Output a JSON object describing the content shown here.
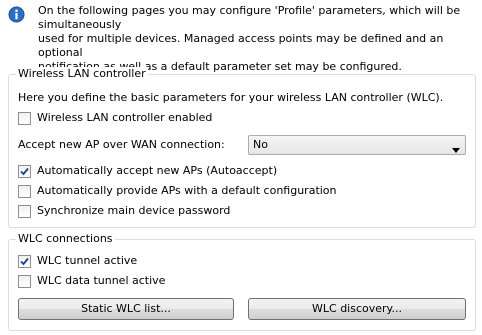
{
  "info": {
    "lines": [
      "On the following pages you may configure 'Profile' parameters, which will be simultaneously",
      "used for multiple devices. Managed access points may be defined and an optional",
      "notification as well as a default parameter set may be configured."
    ],
    "icon": "info-icon"
  },
  "wlc": {
    "title": "Wireless LAN controller",
    "description": "Here you define the basic parameters for your wireless LAN controller (WLC).",
    "enabled": {
      "label": "Wireless LAN controller enabled",
      "checked": false
    },
    "accept_wan": {
      "label": "Accept new AP over WAN connection:",
      "value": "No"
    },
    "autoaccept": {
      "label": "Automatically accept new APs (Autoaccept)",
      "checked": true
    },
    "default_config": {
      "label": "Automatically provide APs with a default configuration",
      "checked": false
    },
    "sync_password": {
      "label": "Synchronize main device password",
      "checked": false
    }
  },
  "connections": {
    "title": "WLC connections",
    "tunnel_active": {
      "label": "WLC tunnel active",
      "checked": true
    },
    "data_tunnel_active": {
      "label": "WLC data tunnel active",
      "checked": false
    },
    "static_list_button": "Static WLC list...",
    "discovery_button": "WLC discovery..."
  }
}
